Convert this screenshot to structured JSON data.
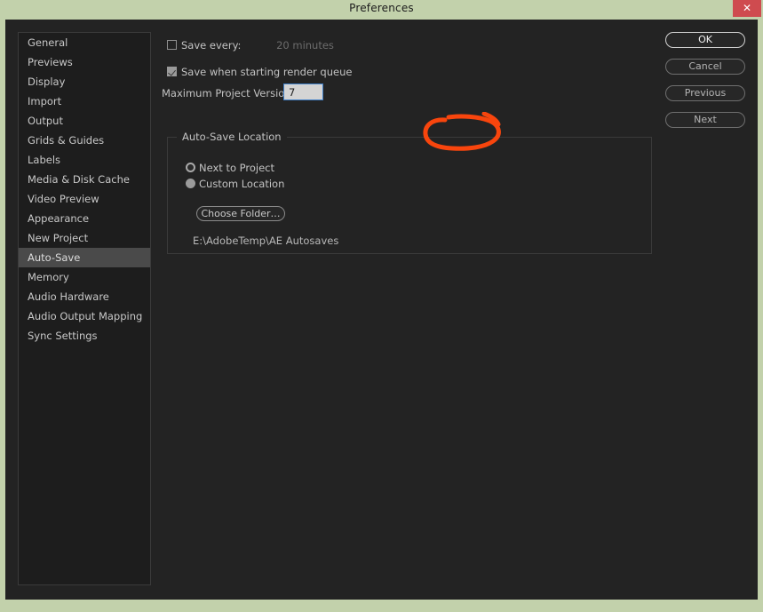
{
  "window": {
    "title": "Preferences",
    "close_label": "✕",
    "close_icon": "close-icon"
  },
  "colors": {
    "desktop_background": "#c2d1ab",
    "dialog_background": "#232323",
    "sidebar_background": "#1d1d1d",
    "selection": "#4a4a4a",
    "close_button": "#cf4b4f",
    "input_border_focus": "#3f7fc8",
    "input_field": "#d4d4d4",
    "annotation_red": "#f8450d"
  },
  "sidebar": {
    "items": [
      {
        "label": "General",
        "selected": false
      },
      {
        "label": "Previews",
        "selected": false
      },
      {
        "label": "Display",
        "selected": false
      },
      {
        "label": "Import",
        "selected": false
      },
      {
        "label": "Output",
        "selected": false
      },
      {
        "label": "Grids & Guides",
        "selected": false
      },
      {
        "label": "Labels",
        "selected": false
      },
      {
        "label": "Media & Disk Cache",
        "selected": false
      },
      {
        "label": "Video Preview",
        "selected": false
      },
      {
        "label": "Appearance",
        "selected": false
      },
      {
        "label": "New Project",
        "selected": false
      },
      {
        "label": "Auto-Save",
        "selected": true
      },
      {
        "label": "Memory",
        "selected": false
      },
      {
        "label": "Audio Hardware",
        "selected": false
      },
      {
        "label": "Audio Output Mapping",
        "selected": false
      },
      {
        "label": "Sync Settings",
        "selected": false
      }
    ]
  },
  "main": {
    "save_every": {
      "label": "Save every:",
      "checked": false,
      "value": "20 minutes"
    },
    "save_render_queue": {
      "label": "Save when starting render queue",
      "checked": true
    },
    "max_versions": {
      "label": "Maximum Project Versions:",
      "value": "7"
    },
    "group": {
      "legend": "Auto-Save Location",
      "radios": [
        {
          "label": "Next to Project",
          "state": "ring"
        },
        {
          "label": "Custom Location",
          "state": "solid"
        }
      ],
      "choose_folder_label": "Choose Folder…",
      "path": "E:\\AdobeTemp\\AE Autosaves"
    }
  },
  "buttons": [
    {
      "label": "OK",
      "name": "ok-button",
      "default": true
    },
    {
      "label": "Cancel",
      "name": "cancel-button",
      "default": false
    },
    {
      "label": "Previous",
      "name": "previous-button",
      "default": false
    },
    {
      "label": "Next",
      "name": "next-button",
      "default": false
    }
  ],
  "annotation": {
    "shape": "hand-drawn-oval",
    "target": "Maximum Project Versions input field",
    "color": "#f8450d"
  }
}
